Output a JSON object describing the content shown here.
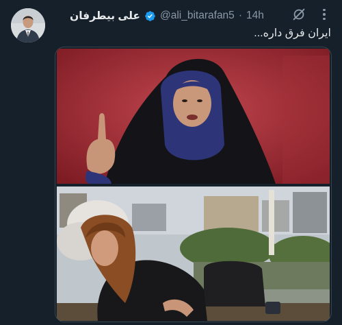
{
  "author": {
    "display_name": "علی بیطرفان",
    "handle": "@ali_bitarafan5",
    "separator": "·",
    "time": "14h",
    "verified": true
  },
  "tweet": {
    "text": "ایران فرق داره..."
  },
  "icons": [
    "avatar",
    "verified-badge-icon",
    "grok-icon",
    "more-icon"
  ],
  "colors": {
    "background": "#15202b",
    "text": "#e7e9ea",
    "secondary_text": "#8b98a5",
    "verified_blue": "#1d9bf0",
    "border": "#38444d"
  },
  "media": {
    "count": 2
  }
}
